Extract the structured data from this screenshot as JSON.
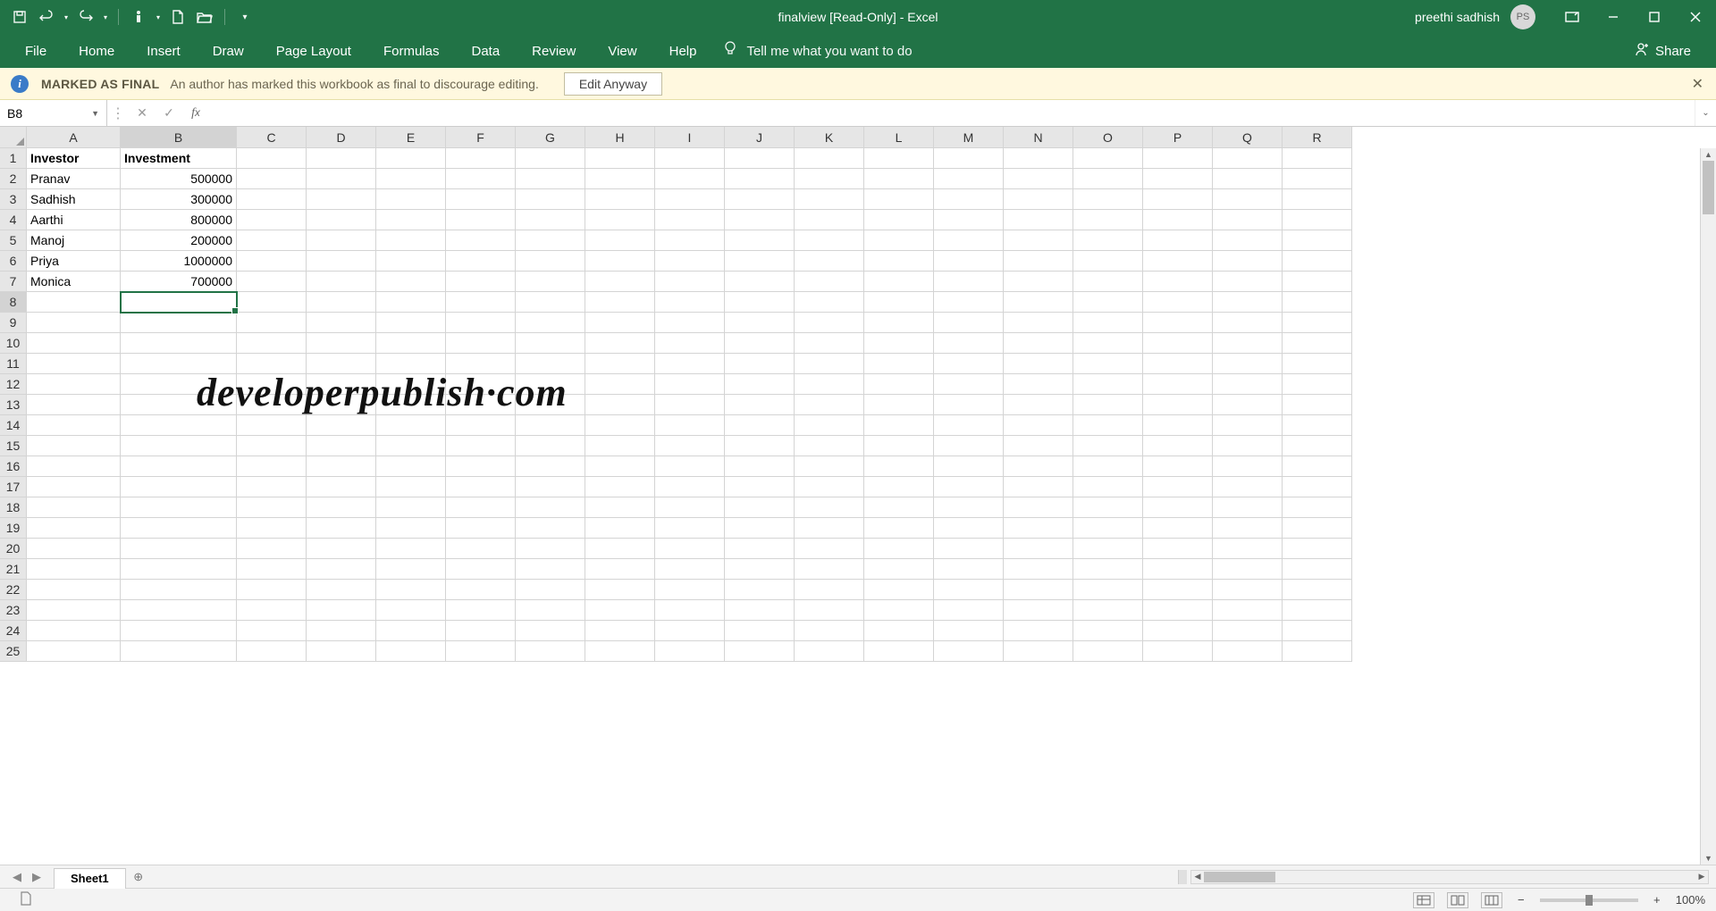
{
  "title": "finalview  [Read-Only]  -  Excel",
  "user": {
    "name": "preethi sadhish",
    "initials": "PS"
  },
  "ribbon": {
    "tabs": [
      "File",
      "Home",
      "Insert",
      "Draw",
      "Page Layout",
      "Formulas",
      "Data",
      "Review",
      "View",
      "Help"
    ],
    "tellme": "Tell me what you want to do",
    "share": "Share"
  },
  "infobar": {
    "strong": "MARKED AS FINAL",
    "text": "An author has marked this workbook as final to discourage editing.",
    "button": "Edit Anyway"
  },
  "formula": {
    "nameBox": "B8",
    "value": ""
  },
  "columns": [
    "A",
    "B",
    "C",
    "D",
    "E",
    "F",
    "G",
    "H",
    "I",
    "J",
    "K",
    "L",
    "M",
    "N",
    "O",
    "P",
    "Q",
    "R"
  ],
  "rows": 25,
  "selected": {
    "row": 8,
    "col": "B"
  },
  "sheet": {
    "active": "Sheet1"
  },
  "zoom": "100%",
  "watermark": "developerpublish·com",
  "cells": {
    "headerRow": {
      "A": "Investor",
      "B": "Investment"
    },
    "data": [
      {
        "A": "Pranav",
        "B": "500000"
      },
      {
        "A": "Sadhish",
        "B": "300000"
      },
      {
        "A": "Aarthi",
        "B": "800000"
      },
      {
        "A": "Manoj",
        "B": "200000"
      },
      {
        "A": "Priya",
        "B": "1000000"
      },
      {
        "A": "Monica",
        "B": "700000"
      }
    ]
  },
  "chart_data": {
    "type": "table",
    "columns": [
      "Investor",
      "Investment"
    ],
    "rows": [
      [
        "Pranav",
        500000
      ],
      [
        "Sadhish",
        300000
      ],
      [
        "Aarthi",
        800000
      ],
      [
        "Manoj",
        200000
      ],
      [
        "Priya",
        1000000
      ],
      [
        "Monica",
        700000
      ]
    ]
  }
}
